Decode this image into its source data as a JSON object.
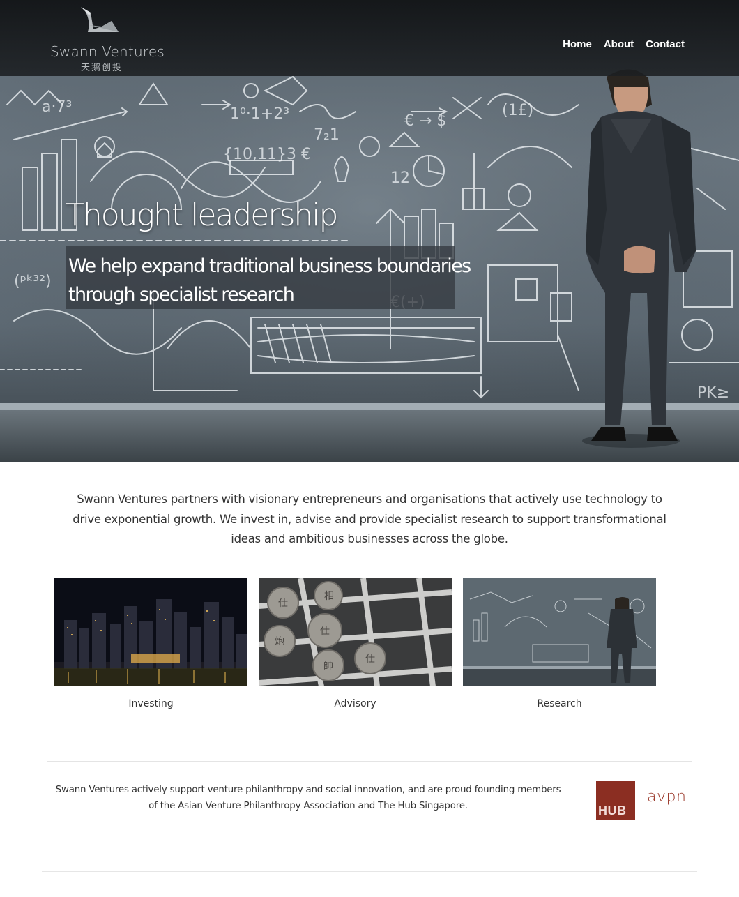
{
  "brand": {
    "name": "Swann Ventures",
    "chinese_name": "天鹅创投"
  },
  "nav": {
    "items": [
      {
        "label": "Home"
      },
      {
        "label": "About"
      },
      {
        "label": "Contact"
      }
    ]
  },
  "hero": {
    "title": "Thought leadership",
    "subtitle_line1": "We help expand traditional business boundaries",
    "subtitle_line2": "through specialist research"
  },
  "intro": {
    "text": "Swann Ventures partners with visionary entrepreneurs and organisations that actively use technology to drive exponential growth. We invest in, advise and provide specialist research to support transformational ideas and ambitious businesses across the globe."
  },
  "services": [
    {
      "label": "Investing"
    },
    {
      "label": "Advisory"
    },
    {
      "label": "Research"
    }
  ],
  "philanthropy": {
    "text": "Swann Ventures actively support venture philanthropy and social innovation, and are proud founding members of the Asian Venture Philanthropy Association and The Hub Singapore."
  },
  "partners": {
    "hub_label": "HUB",
    "avpn_label": "avpn",
    "hub_color": "#8b2e22",
    "avpn_color": "#9b3a2c"
  },
  "colors": {
    "navbar": "#1a1d20",
    "nav_text": "#ffffff",
    "body_text": "#333333"
  }
}
